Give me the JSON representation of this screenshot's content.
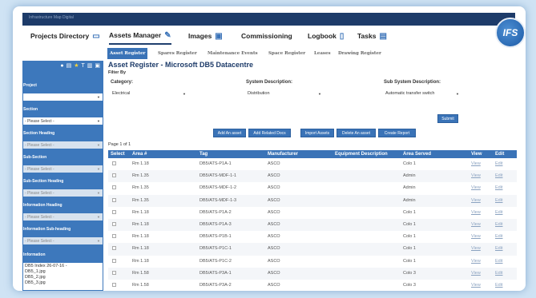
{
  "topbar": {
    "text": "Infrastructure Map Digital"
  },
  "logo": {
    "text": "IFS"
  },
  "nav": [
    {
      "label": "Projects Directory",
      "icon": "folder-icon",
      "glyph": "▭"
    },
    {
      "label": "Assets Manager",
      "icon": "wrench-icon",
      "glyph": "🔧"
    },
    {
      "label": "Images",
      "icon": "image-icon",
      "glyph": "▣"
    },
    {
      "label": "Commissioning",
      "icon": "",
      "glyph": ""
    },
    {
      "label": "Logbook",
      "icon": "book-icon",
      "glyph": "▯"
    },
    {
      "label": "Tasks",
      "icon": "tasks-icon",
      "glyph": "▤"
    }
  ],
  "subnav": [
    "Asset Register",
    "Spares Register",
    "Maintenance Events",
    "Space Register",
    "Leases",
    "Drawing Register"
  ],
  "sidebar": {
    "sections": [
      {
        "label": "Project",
        "value": ""
      },
      {
        "label": "Section",
        "value": "- Please Select -"
      },
      {
        "label": "Section Heading",
        "value": "- Please Select -"
      },
      {
        "label": "Sub-Section",
        "value": "- Please Select -"
      },
      {
        "label": "Sub-Section Heading",
        "value": "- Please Select -"
      },
      {
        "label": "Information Heading",
        "value": "- Please Select -"
      },
      {
        "label": "Information Sub-heading",
        "value": "- Please Select -"
      },
      {
        "label": "Information",
        "value": ""
      }
    ],
    "files": [
      "DB5 Index 26-07-16 -",
      "DB5_1.jpg",
      "DB5_2.jpg",
      "DB5_3.jpg"
    ]
  },
  "content": {
    "title": "Asset Register - Microsoft DB5 Datacentre",
    "filter_by": "Filter By",
    "category_label": "Category:",
    "category_value": "Electrical",
    "system_label": "System Description:",
    "system_value": "Distribution",
    "subsystem_label": "Sub System Description:",
    "subsystem_value": "Automatic transfer switch",
    "submit": "Submit",
    "buttons": [
      "Add An asset",
      "Add Related Docs",
      "Import Assets",
      "Delete An asset",
      "Create Report"
    ],
    "page_of": "Page 1 of 1"
  },
  "table": {
    "headers": [
      "Select",
      "Area #",
      "Tag",
      "Manufacturer",
      "Equipment Description",
      "Area Served",
      "View",
      "Edit"
    ],
    "rows": [
      {
        "area": "Rm 1.18",
        "tag": "DB5/ATS-P1A-1",
        "mfr": "ASCO",
        "served": "Colo 1"
      },
      {
        "area": "Rm 1.35",
        "tag": "DB5/ATS-MDF-1-1",
        "mfr": "ASCO",
        "served": "Admin"
      },
      {
        "area": "Rm 1.35",
        "tag": "DB5/ATS-MDF-1-2",
        "mfr": "ASCO",
        "served": "Admin"
      },
      {
        "area": "Rm 1.35",
        "tag": "DB5/ATS-MDF-1-3",
        "mfr": "ASCO",
        "served": "Admin"
      },
      {
        "area": "Rm 1.18",
        "tag": "DB5/ATS-P1A-2",
        "mfr": "ASCO",
        "served": "Colo 1"
      },
      {
        "area": "Rm 1.18",
        "tag": "DB5/ATS-P1A-3",
        "mfr": "ASCO",
        "served": "Colo 1"
      },
      {
        "area": "Rm 1.18",
        "tag": "DB5/ATS-P1B-1",
        "mfr": "ASCO",
        "served": "Colo 1"
      },
      {
        "area": "Rm 1.18",
        "tag": "DB5/ATS-P1C-1",
        "mfr": "ASCO",
        "served": "Colo 1"
      },
      {
        "area": "Rm 1.18",
        "tag": "DB5/ATS-P1C-2",
        "mfr": "ASCO",
        "served": "Colo 1"
      },
      {
        "area": "Rm 1.58",
        "tag": "DB5/ATS-P3A-1",
        "mfr": "ASCO",
        "served": "Colo 3"
      },
      {
        "area": "Rm 1.58",
        "tag": "DB5/ATS-P3A-2",
        "mfr": "ASCO",
        "served": "Colo 3"
      }
    ],
    "view": "View",
    "edit": "Edit"
  },
  "colors": {
    "accent": "#3a73b7",
    "dark": "#1d3b69",
    "bg": "#cfe3f4"
  }
}
